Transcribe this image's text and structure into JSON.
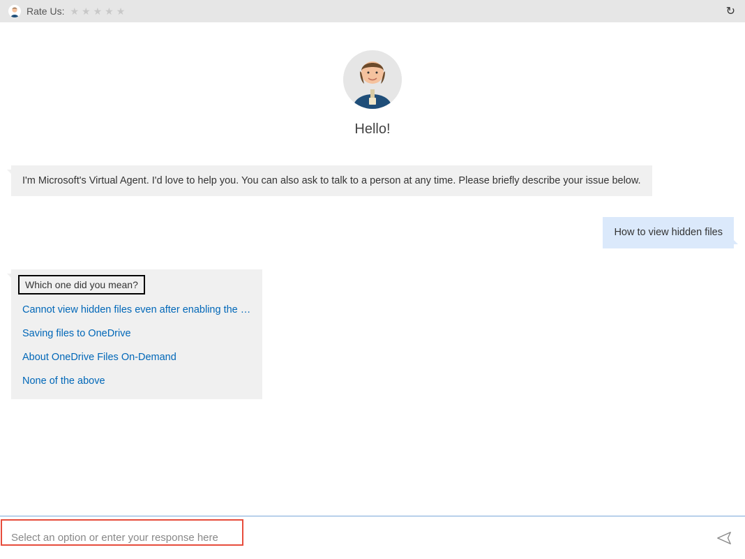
{
  "header": {
    "rate_label": "Rate Us:"
  },
  "agent": {
    "greeting": "Hello!",
    "intro_message": "I'm Microsoft's Virtual Agent. I'd love to help you. You can also ask to talk to a person at any time. Please briefly describe your issue below."
  },
  "user_message": "How to view hidden files",
  "options": {
    "title": "Which one did you mean?",
    "items": [
      "Cannot view hidden files even after enabling the Show ...",
      "Saving files to OneDrive",
      "About OneDrive Files On-Demand",
      "None of the above"
    ]
  },
  "input": {
    "placeholder": "Select an option or enter your response here"
  }
}
